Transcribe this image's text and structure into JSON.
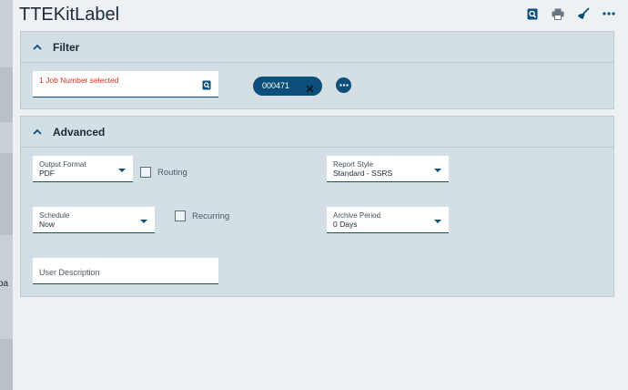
{
  "app": {
    "title": "TTEKitLabel",
    "left_strip_text": "pa"
  },
  "toolbar": {
    "icons": [
      "search-doc-icon",
      "print-icon",
      "clear-broom-icon",
      "more-icon"
    ]
  },
  "filter": {
    "header": "Filter",
    "job_field_text": "1 Job Number selected",
    "chip_label": "000471"
  },
  "advanced": {
    "header": "Advanced",
    "output_format": {
      "label": "Output Format",
      "value": "PDF"
    },
    "routing_label": "Routing",
    "report_style": {
      "label": "Report Style",
      "value": "Standard - SSRS"
    },
    "schedule": {
      "label": "Schedule",
      "value": "Now"
    },
    "recurring_label": "Recurring",
    "archive_period": {
      "label": "Archive Period",
      "value": "0 Days"
    },
    "user_description_placeholder": "User Description"
  },
  "colors": {
    "accent": "#0b4f7a",
    "panel": "#d3dee5",
    "error_text": "#d9321f"
  }
}
